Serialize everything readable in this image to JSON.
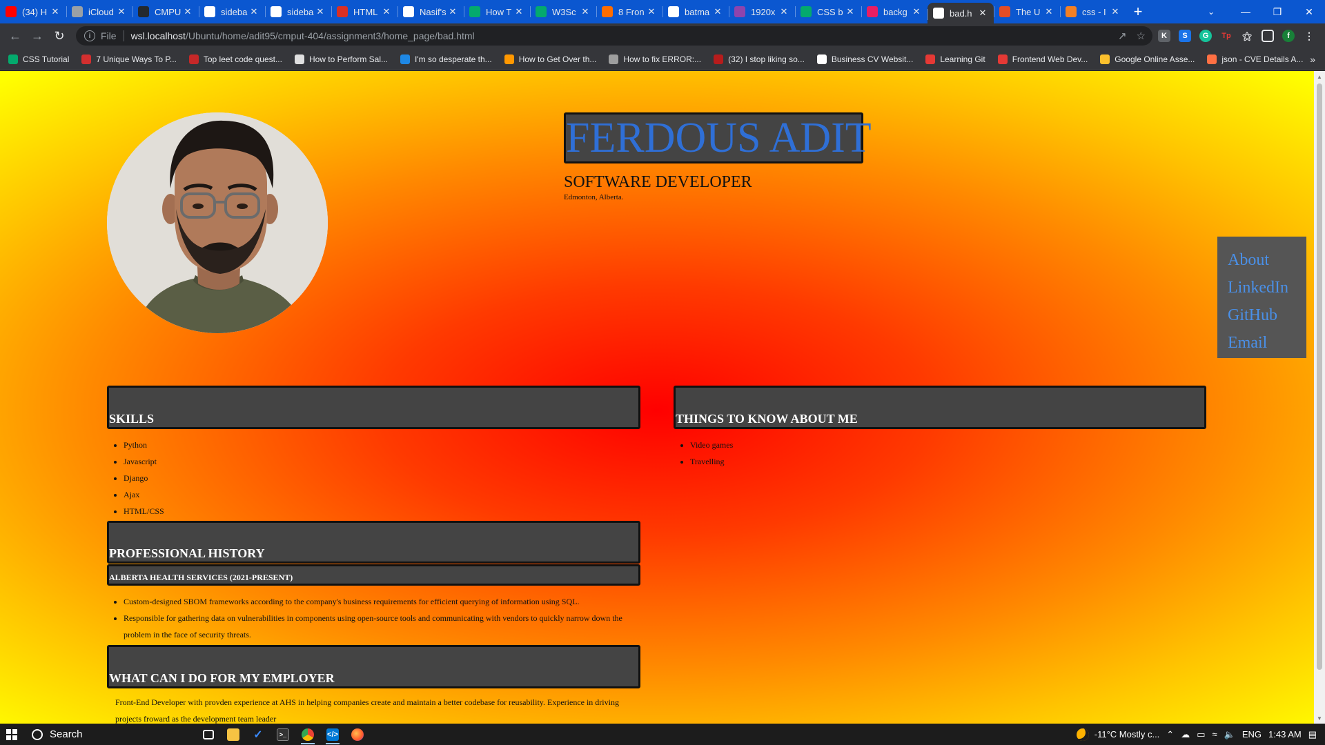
{
  "browser": {
    "tabs": [
      {
        "label": "(34) H",
        "fav": "youtube-icon",
        "color": "#ff0000"
      },
      {
        "label": "iCloud",
        "fav": "apple-icon",
        "color": "#9aa0a6"
      },
      {
        "label": "CMPU",
        "fav": "github-icon",
        "color": "#24292e"
      },
      {
        "label": "sideba",
        "fav": "google-icon",
        "color": "#ffffff"
      },
      {
        "label": "sideba",
        "fav": "google-icon",
        "color": "#ffffff"
      },
      {
        "label": "HTML",
        "fav": "pen-icon",
        "color": "#d93025"
      },
      {
        "label": "Nasif's",
        "fav": "globe-icon",
        "color": "#ffffff"
      },
      {
        "label": "How T",
        "fav": "w3-icon",
        "color": "#04aa6d"
      },
      {
        "label": "W3Sc",
        "fav": "w3-icon",
        "color": "#04aa6d"
      },
      {
        "label": "8 Fron",
        "fav": "circle-icon",
        "color": "#ff6d00"
      },
      {
        "label": "batma",
        "fav": "google-icon",
        "color": "#ffffff"
      },
      {
        "label": "1920x",
        "fav": "image-icon",
        "color": "#8e44ad"
      },
      {
        "label": "CSS b",
        "fav": "w3-icon",
        "color": "#04aa6d"
      },
      {
        "label": "backg",
        "fav": "star-icon",
        "color": "#e91e63"
      },
      {
        "label": "bad.h",
        "fav": "globe-icon",
        "color": "#ffffff",
        "active": true
      },
      {
        "label": "The U",
        "fav": "html5-icon",
        "color": "#e44d26"
      },
      {
        "label": "css - I",
        "fav": "stack-icon",
        "color": "#f48024"
      }
    ],
    "url_scheme": "File",
    "url_host": "wsl.localhost",
    "url_path": "/Ubuntu/home/adit95/cmput-404/assignment3/home_page/bad.html",
    "bookmarks": [
      {
        "label": "CSS Tutorial",
        "color": "#04aa6d"
      },
      {
        "label": "7 Unique Ways To P...",
        "color": "#d32f2f"
      },
      {
        "label": "Top leet code quest...",
        "color": "#c62828"
      },
      {
        "label": "How to Perform Sal...",
        "color": "#e0e0e0"
      },
      {
        "label": "I'm so desperate th...",
        "color": "#1e88e5"
      },
      {
        "label": "How to Get Over th...",
        "color": "#ff9800"
      },
      {
        "label": "How to fix ERROR:...",
        "color": "#9e9e9e"
      },
      {
        "label": "(32) I stop liking so...",
        "color": "#b71c1c"
      },
      {
        "label": "Business CV Websit...",
        "color": "#ffffff"
      },
      {
        "label": "Learning Git",
        "color": "#e53935"
      },
      {
        "label": "Frontend Web Dev...",
        "color": "#e53935"
      },
      {
        "label": "Google Online Asse...",
        "color": "#fbc02d"
      },
      {
        "label": "json - CVE Details A...",
        "color": "#ff7043"
      }
    ]
  },
  "page": {
    "name": "FERDOUS ADIT",
    "role": "SOFTWARE DEVELOPER",
    "location": "Edmonton, Alberta.",
    "nav": [
      "About",
      "LinkedIn",
      "GitHub",
      "Email"
    ],
    "skills_heading": "SKILLS",
    "skills": [
      "Python",
      "Javascript",
      "Django",
      "Ajax",
      "HTML/CSS"
    ],
    "things_heading": "THINGS TO KNOW ABOUT ME",
    "things": [
      "Video games",
      "Travelling"
    ],
    "history_heading": "PROFESSIONAL HISTORY",
    "job_title": "ALBERTA HEALTH SERVICES (2021-PRESENT)",
    "job_items": [
      "Custom-designed SBOM frameworks according to the company's business requirements for efficient querying of information using SQL.",
      "Responsible for gathering data on vulnerabilities in components using open-source tools and communicating with vendors to quickly narrow down the problem in the face of security threats."
    ],
    "employer_heading": "WHAT CAN I DO FOR MY EMPLOYER",
    "employer_text": "Front-End Developer with provden experience at AHS in helping companies create and maintain a better codebase for reusability. Experience in driving projects froward as the development team leader"
  },
  "taskbar": {
    "search_label": "Search",
    "weather": "-11°C  Mostly c...",
    "lang": "ENG",
    "time": "1:43 AM"
  },
  "colors": {
    "gradient_center": "#ff0000",
    "gradient_edge": "#ffff00",
    "heading_box": "#444444",
    "name_text": "#2f6fd6",
    "nav_link": "#4a90e8"
  }
}
